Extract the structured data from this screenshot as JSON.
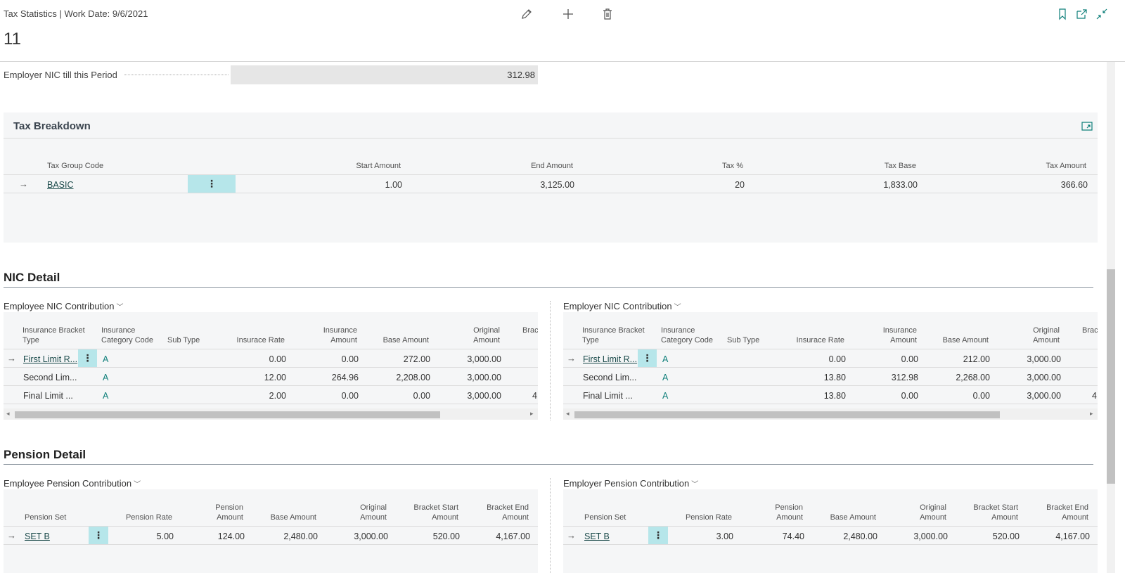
{
  "header": {
    "breadcrumb": "Tax Statistics | Work Date: 9/6/2021",
    "record_no": "11"
  },
  "field": {
    "label": "Employer NIC till this Period",
    "value": "312.98"
  },
  "tax_breakdown": {
    "title": "Tax Breakdown",
    "columns": [
      "Tax Group Code",
      "Start Amount",
      "End Amount",
      "Tax %",
      "Tax Base",
      "Tax Amount"
    ],
    "rows": [
      {
        "code": "BASIC",
        "start": "1.00",
        "end": "3,125.00",
        "tax_pct": "20",
        "base": "1,833.00",
        "amount": "366.60"
      }
    ]
  },
  "nic_detail": {
    "title": "NIC Detail",
    "employee": {
      "title": "Employee NIC Contribution",
      "columns": {
        "bracket_type": "Insurance Bracket Type",
        "category": "Insurance Category Code",
        "sub_type": "Sub Type",
        "rate": "Insurace Rate",
        "ins_amount": "Insurance Amount",
        "base": "Base Amount",
        "original": "Original Amount",
        "brac": "Brac"
      },
      "rows": [
        {
          "bracket_type": "First Limit R...",
          "category": "A",
          "rate": "0.00",
          "ins_amount": "0.00",
          "base": "272.00",
          "original": "3,000.00",
          "brac": ""
        },
        {
          "bracket_type": "Second Lim...",
          "category": "A",
          "rate": "12.00",
          "ins_amount": "264.96",
          "base": "2,208.00",
          "original": "3,000.00",
          "brac": ""
        },
        {
          "bracket_type": "Final Limit ...",
          "category": "A",
          "rate": "2.00",
          "ins_amount": "0.00",
          "base": "0.00",
          "original": "3,000.00",
          "brac": "4"
        }
      ]
    },
    "employer": {
      "title": "Employer NIC  Contribution",
      "columns": {
        "bracket_type": "Insurance Bracket Type",
        "category": "Insurance Category Code",
        "sub_type": "Sub Type",
        "rate": "Insurace Rate",
        "ins_amount": "Insurance Amount",
        "base": "Base Amount",
        "original": "Original Amount",
        "brac": "Brac"
      },
      "rows": [
        {
          "bracket_type": "First Limit R...",
          "category": "A",
          "rate": "0.00",
          "ins_amount": "0.00",
          "base": "212.00",
          "original": "3,000.00",
          "brac": ""
        },
        {
          "bracket_type": "Second Lim...",
          "category": "A",
          "rate": "13.80",
          "ins_amount": "312.98",
          "base": "2,268.00",
          "original": "3,000.00",
          "brac": ""
        },
        {
          "bracket_type": "Final Limit ...",
          "category": "A",
          "rate": "13.80",
          "ins_amount": "0.00",
          "base": "0.00",
          "original": "3,000.00",
          "brac": "4"
        }
      ]
    }
  },
  "pension_detail": {
    "title": "Pension Detail",
    "employee": {
      "title": "Employee Pension Contribution",
      "columns": {
        "set": "Pension Set",
        "rate": "Pension Rate",
        "amount": "Pension Amount",
        "base": "Base Amount",
        "original": "Original Amount",
        "start": "Bracket Start Amount",
        "end": "Bracket End Amount"
      },
      "rows": [
        {
          "set": "SET B",
          "rate": "5.00",
          "amount": "124.00",
          "base": "2,480.00",
          "original": "3,000.00",
          "start": "520.00",
          "end": "4,167.00"
        }
      ]
    },
    "employer": {
      "title": "Employer Pension Contribution",
      "columns": {
        "set": "Pension Set",
        "rate": "Pension Rate",
        "amount": "Pension Amount",
        "base": "Base Amount",
        "original": "Original Amount",
        "start": "Bracket Start Amount",
        "end": "Bracket End Amount"
      },
      "rows": [
        {
          "set": "SET B",
          "rate": "3.00",
          "amount": "74.40",
          "base": "2,480.00",
          "original": "3,000.00",
          "start": "520.00",
          "end": "4,167.00"
        }
      ]
    }
  },
  "icons": {
    "edit": "pencil-icon",
    "new": "plus-icon",
    "delete": "trash-icon",
    "bookmark": "bookmark-icon",
    "open_new": "open-new-window-icon",
    "collapse": "collapse-icon",
    "expand_part": "expand-part-icon"
  },
  "colors": {
    "accent": "#0e7f7a",
    "selected_cell": "#b6e6ea",
    "panel_bg": "#f5f6f7"
  }
}
